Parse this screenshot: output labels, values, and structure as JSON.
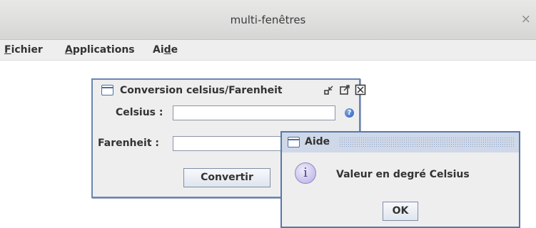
{
  "window": {
    "title": "multi-fenêtres",
    "close_glyph": "×"
  },
  "menubar": {
    "items": [
      {
        "pre": "",
        "mnemonic": "F",
        "post": "ichier"
      },
      {
        "pre": "",
        "mnemonic": "A",
        "post": "pplications"
      },
      {
        "pre": "Ai",
        "mnemonic": "d",
        "post": "e"
      }
    ]
  },
  "conversion_frame": {
    "title": "Conversion celsius/Farenheit",
    "celsius_label": "Celsius :",
    "celsius_value": "",
    "farenheit_label": "Farenheit :",
    "farenheit_value": "",
    "convert_label": "Convertir",
    "help_glyph": "?"
  },
  "aide_frame": {
    "title": "Aide",
    "message": "Valeur en degré Celsius",
    "ok_label": "OK",
    "info_glyph": "i"
  },
  "colors": {
    "frame_border": "#6a86b2",
    "help_icon": "#2b5fb8",
    "info_icon": "#b5aee0"
  }
}
